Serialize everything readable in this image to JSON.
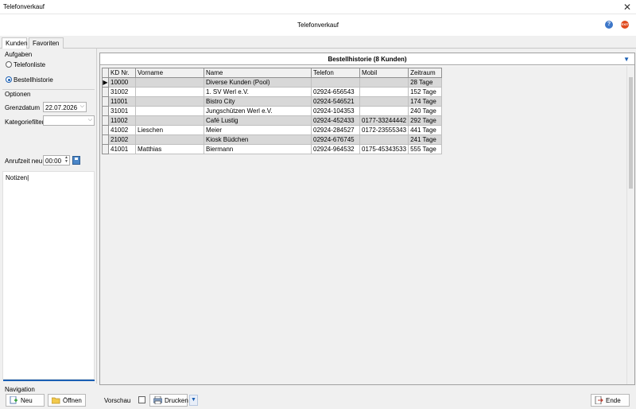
{
  "window": {
    "title": "Telefonverkauf",
    "close_glyph": "✕"
  },
  "header": {
    "title": "Telefonverkauf",
    "help_glyph": "?",
    "exit_glyph": "EXIT"
  },
  "tabs": [
    {
      "label": "Kunden",
      "active": true
    },
    {
      "label": "Favoriten",
      "active": false
    }
  ],
  "left": {
    "aufgaben_label": "Aufgaben",
    "radio_telefonliste": "Telefonliste",
    "radio_bestellhistorie": "Bestellhistorie",
    "optionen_label": "Optionen",
    "grenzdatum_label": "Grenzdatum",
    "grenzdatum_value": "22.07.2026",
    "kategoriefilter_label": "Kategoriefilter",
    "kategoriefilter_value": "",
    "anrufzeit_label": "Anrufzeit neu",
    "anrufzeit_value": "00:00",
    "notizen_text": "Notizen"
  },
  "grid": {
    "title": "Bestellhistorie (8 Kunden)",
    "columns": [
      "KD Nr.",
      "Vorname",
      "Name",
      "Telefon",
      "Mobil",
      "Zeitraum"
    ],
    "rows": [
      [
        "10000",
        "",
        "Diverse Kunden (Pool)",
        "",
        "",
        "28 Tage"
      ],
      [
        "31002",
        "",
        "1. SV Werl e.V.",
        "02924-656543",
        "",
        "152 Tage"
      ],
      [
        "11001",
        "",
        "Bistro City",
        "02924-546521",
        "",
        "174 Tage"
      ],
      [
        "31001",
        "",
        "Jungschützen Werl e.V.",
        "02924-104353",
        "",
        "240 Tage"
      ],
      [
        "11002",
        "",
        "Café Lustig",
        "02924-452433",
        "0177-33244442",
        "292 Tage"
      ],
      [
        "41002",
        "Lieschen",
        "Meier",
        "02924-284527",
        "0172-23555343",
        "441 Tage"
      ],
      [
        "21002",
        "",
        "Kiosk Büdchen",
        "02924-676745",
        "",
        "241 Tage"
      ],
      [
        "41001",
        "Matthias",
        "Biermann",
        "02924-964532",
        "0175-45343533",
        "555 Tage"
      ]
    ]
  },
  "bottom": {
    "navigation_label": "Navigation",
    "neu_label": "Neu",
    "oeffnen_label": "Öffnen",
    "vorschau_label": "Vorschau",
    "drucken_label": "Drucken",
    "ende_label": "Ende"
  }
}
